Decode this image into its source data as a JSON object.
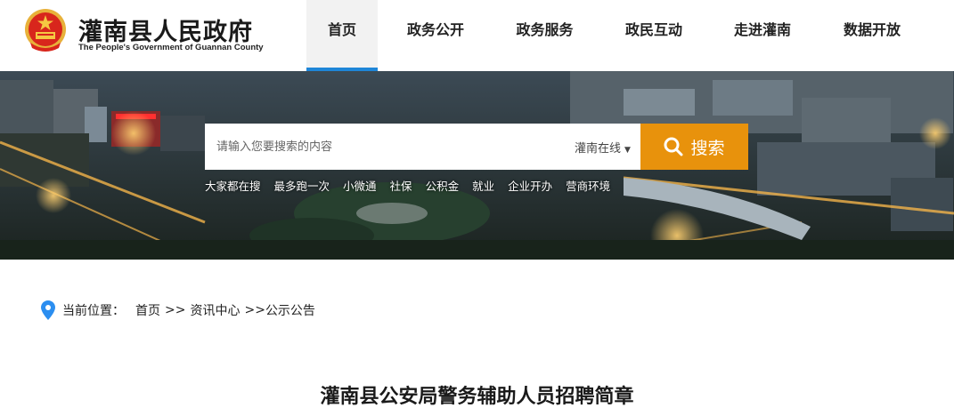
{
  "header": {
    "title": "灌南县人民政府",
    "subtitle": "The People's Government of Guannan County"
  },
  "nav": [
    {
      "label": "首页",
      "active": true
    },
    {
      "label": "政务公开",
      "active": false
    },
    {
      "label": "政务服务",
      "active": false
    },
    {
      "label": "政民互动",
      "active": false
    },
    {
      "label": "走进灌南",
      "active": false
    },
    {
      "label": "数据开放",
      "active": false
    }
  ],
  "search": {
    "placeholder": "请输入您要搜索的内容",
    "scope": "灌南在线",
    "button_label": "搜索"
  },
  "quick_links": [
    "大家都在搜",
    "最多跑一次",
    "小微通",
    "社保",
    "公积金",
    "就业",
    "企业开办",
    "营商环境"
  ],
  "breadcrumb": {
    "label": "当前位置：",
    "items": [
      "首页",
      "资讯中心",
      "公示公告"
    ],
    "separator": ">>"
  },
  "article": {
    "title": "灌南县公安局警务辅助人员招聘简章"
  },
  "colors": {
    "nav_active_underline": "#1f86d8",
    "search_button": "#e8920c",
    "pin": "#2b8ef0"
  }
}
